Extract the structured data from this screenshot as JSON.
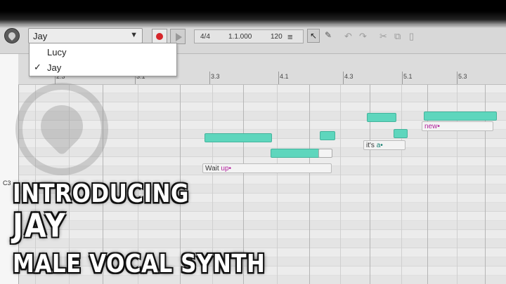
{
  "toolbar": {
    "voice_value": "Jay",
    "dropdown_caret": "▼",
    "time_signature": "4/4",
    "position": "1.1.000",
    "tempo": "120",
    "select_tool_icon": "↖",
    "pencil_tool_icon": "✎",
    "undo_icon": "↶",
    "redo_icon": "↷",
    "cut_icon": "✂",
    "copy_icon": "⧉",
    "paste_icon": "▯",
    "mixer_icon": "≡"
  },
  "voice_menu": {
    "items": [
      {
        "label": "Lucy",
        "checked": false,
        "check": ""
      },
      {
        "label": "Jay",
        "checked": true,
        "check": "✓"
      }
    ]
  },
  "ruler": {
    "labels": [
      "2.3",
      "3.1",
      "3.3",
      "4.1",
      "4.3",
      "5.1",
      "5.3"
    ]
  },
  "keyboard": {
    "c3_label": "C3"
  },
  "lyrics": {
    "wait_prefix": "Wait ",
    "wait_syllable": "up•",
    "its_prefix": "it's ",
    "its_syllable": "a•",
    "new_syllable": "new•"
  },
  "overlay": {
    "line1": "INTRODUCING",
    "line2": "JAY",
    "line3": "MALE VOCAL SYNTH"
  },
  "colors": {
    "note": "#5ed6bd",
    "syllable": "#b2229d",
    "record": "#d6262b"
  }
}
